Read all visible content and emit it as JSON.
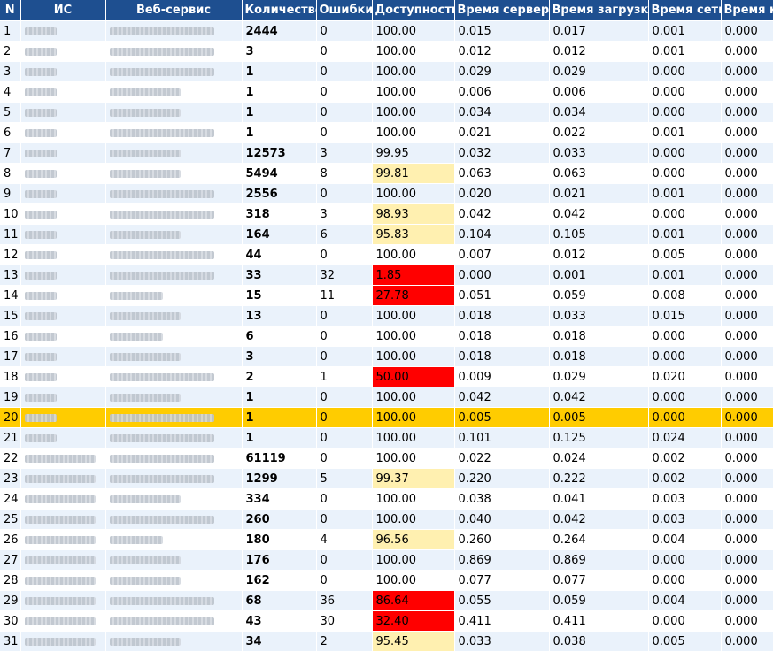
{
  "columns": [
    "N",
    "ИС",
    "Веб-сервис",
    "Количество",
    "Ошибки",
    "Доступность",
    "Время сервера",
    "Время загрузки",
    "Время сети",
    "Время к"
  ],
  "rows": [
    {
      "n": "1",
      "count": "2444",
      "errors": "0",
      "availability": "100.00",
      "status": "ok",
      "server": "0.015",
      "load": "0.017",
      "net": "0.001",
      "client": "0.000"
    },
    {
      "n": "2",
      "count": "3",
      "errors": "0",
      "availability": "100.00",
      "status": "ok",
      "server": "0.012",
      "load": "0.012",
      "net": "0.001",
      "client": "0.000"
    },
    {
      "n": "3",
      "count": "1",
      "errors": "0",
      "availability": "100.00",
      "status": "ok",
      "server": "0.029",
      "load": "0.029",
      "net": "0.000",
      "client": "0.000"
    },
    {
      "n": "4",
      "count": "1",
      "errors": "0",
      "availability": "100.00",
      "status": "ok",
      "server": "0.006",
      "load": "0.006",
      "net": "0.000",
      "client": "0.000"
    },
    {
      "n": "5",
      "count": "1",
      "errors": "0",
      "availability": "100.00",
      "status": "ok",
      "server": "0.034",
      "load": "0.034",
      "net": "0.000",
      "client": "0.000"
    },
    {
      "n": "6",
      "count": "1",
      "errors": "0",
      "availability": "100.00",
      "status": "ok",
      "server": "0.021",
      "load": "0.022",
      "net": "0.001",
      "client": "0.000"
    },
    {
      "n": "7",
      "count": "12573",
      "errors": "3",
      "availability": "99.95",
      "status": "ok",
      "server": "0.032",
      "load": "0.033",
      "net": "0.000",
      "client": "0.000"
    },
    {
      "n": "8",
      "count": "5494",
      "errors": "8",
      "availability": "99.81",
      "status": "warn",
      "server": "0.063",
      "load": "0.063",
      "net": "0.000",
      "client": "0.000"
    },
    {
      "n": "9",
      "count": "2556",
      "errors": "0",
      "availability": "100.00",
      "status": "ok",
      "server": "0.020",
      "load": "0.021",
      "net": "0.001",
      "client": "0.000"
    },
    {
      "n": "10",
      "count": "318",
      "errors": "3",
      "availability": "98.93",
      "status": "warn",
      "server": "0.042",
      "load": "0.042",
      "net": "0.000",
      "client": "0.000"
    },
    {
      "n": "11",
      "count": "164",
      "errors": "6",
      "availability": "95.83",
      "status": "warn",
      "server": "0.104",
      "load": "0.105",
      "net": "0.001",
      "client": "0.000"
    },
    {
      "n": "12",
      "count": "44",
      "errors": "0",
      "availability": "100.00",
      "status": "ok",
      "server": "0.007",
      "load": "0.012",
      "net": "0.005",
      "client": "0.000"
    },
    {
      "n": "13",
      "count": "33",
      "errors": "32",
      "availability": "1.85",
      "status": "bad",
      "server": "0.000",
      "load": "0.001",
      "net": "0.001",
      "client": "0.000"
    },
    {
      "n": "14",
      "count": "15",
      "errors": "11",
      "availability": "27.78",
      "status": "bad",
      "server": "0.051",
      "load": "0.059",
      "net": "0.008",
      "client": "0.000"
    },
    {
      "n": "15",
      "count": "13",
      "errors": "0",
      "availability": "100.00",
      "status": "ok",
      "server": "0.018",
      "load": "0.033",
      "net": "0.015",
      "client": "0.000"
    },
    {
      "n": "16",
      "count": "6",
      "errors": "0",
      "availability": "100.00",
      "status": "ok",
      "server": "0.018",
      "load": "0.018",
      "net": "0.000",
      "client": "0.000"
    },
    {
      "n": "17",
      "count": "3",
      "errors": "0",
      "availability": "100.00",
      "status": "ok",
      "server": "0.018",
      "load": "0.018",
      "net": "0.000",
      "client": "0.000"
    },
    {
      "n": "18",
      "count": "2",
      "errors": "1",
      "availability": "50.00",
      "status": "bad",
      "server": "0.009",
      "load": "0.029",
      "net": "0.020",
      "client": "0.000"
    },
    {
      "n": "19",
      "count": "1",
      "errors": "0",
      "availability": "100.00",
      "status": "ok",
      "server": "0.042",
      "load": "0.042",
      "net": "0.000",
      "client": "0.000"
    },
    {
      "n": "20",
      "count": "1",
      "errors": "0",
      "availability": "100.00",
      "status": "ok",
      "server": "0.005",
      "load": "0.005",
      "net": "0.000",
      "client": "0.000",
      "selected": true
    },
    {
      "n": "21",
      "count": "1",
      "errors": "0",
      "availability": "100.00",
      "status": "ok",
      "server": "0.101",
      "load": "0.125",
      "net": "0.024",
      "client": "0.000"
    },
    {
      "n": "22",
      "count": "61119",
      "errors": "0",
      "availability": "100.00",
      "status": "ok",
      "server": "0.022",
      "load": "0.024",
      "net": "0.002",
      "client": "0.000"
    },
    {
      "n": "23",
      "count": "1299",
      "errors": "5",
      "availability": "99.37",
      "status": "warn",
      "server": "0.220",
      "load": "0.222",
      "net": "0.002",
      "client": "0.000"
    },
    {
      "n": "24",
      "count": "334",
      "errors": "0",
      "availability": "100.00",
      "status": "ok",
      "server": "0.038",
      "load": "0.041",
      "net": "0.003",
      "client": "0.000"
    },
    {
      "n": "25",
      "count": "260",
      "errors": "0",
      "availability": "100.00",
      "status": "ok",
      "server": "0.040",
      "load": "0.042",
      "net": "0.003",
      "client": "0.000"
    },
    {
      "n": "26",
      "count": "180",
      "errors": "4",
      "availability": "96.56",
      "status": "warn",
      "server": "0.260",
      "load": "0.264",
      "net": "0.004",
      "client": "0.000"
    },
    {
      "n": "27",
      "count": "176",
      "errors": "0",
      "availability": "100.00",
      "status": "ok",
      "server": "0.869",
      "load": "0.869",
      "net": "0.000",
      "client": "0.000"
    },
    {
      "n": "28",
      "count": "162",
      "errors": "0",
      "availability": "100.00",
      "status": "ok",
      "server": "0.077",
      "load": "0.077",
      "net": "0.000",
      "client": "0.000"
    },
    {
      "n": "29",
      "count": "68",
      "errors": "36",
      "availability": "86.64",
      "status": "bad",
      "server": "0.055",
      "load": "0.059",
      "net": "0.004",
      "client": "0.000"
    },
    {
      "n": "30",
      "count": "43",
      "errors": "30",
      "availability": "32.40",
      "status": "bad",
      "server": "0.411",
      "load": "0.411",
      "net": "0.000",
      "client": "0.000"
    },
    {
      "n": "31",
      "count": "34",
      "errors": "2",
      "availability": "95.45",
      "status": "warn",
      "server": "0.033",
      "load": "0.038",
      "net": "0.005",
      "client": "0.000"
    }
  ],
  "colors": {
    "header": "#1e4f90",
    "row_alt": "#eaf2fb",
    "selected": "#ffcc00",
    "warn": "#fff0b0",
    "bad": "#ff0000"
  }
}
